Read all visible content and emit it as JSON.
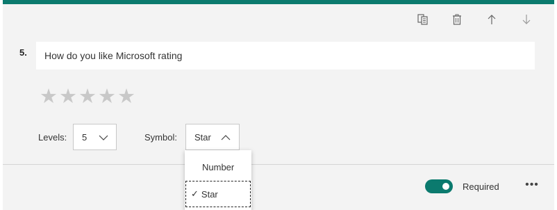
{
  "toolbar": {
    "icons": [
      "copy-icon",
      "trash-icon",
      "arrow-up-icon",
      "arrow-down-icon"
    ]
  },
  "question": {
    "number": "5.",
    "title": "How do you like Microsoft rating",
    "stars": [
      "★",
      "★",
      "★",
      "★",
      "★"
    ]
  },
  "levels": {
    "label": "Levels:",
    "value": "5"
  },
  "symbol": {
    "label": "Symbol:",
    "value": "Star",
    "options": [
      "Number",
      "Star"
    ],
    "selected_index": 1,
    "check_glyph": "✓"
  },
  "footer": {
    "required_label": "Required",
    "required_on": true,
    "more_glyph": "•••"
  },
  "colors": {
    "accent": "#0b7a6e",
    "card_bg": "#f3f3f3",
    "star_empty": "#c8c8c8"
  }
}
